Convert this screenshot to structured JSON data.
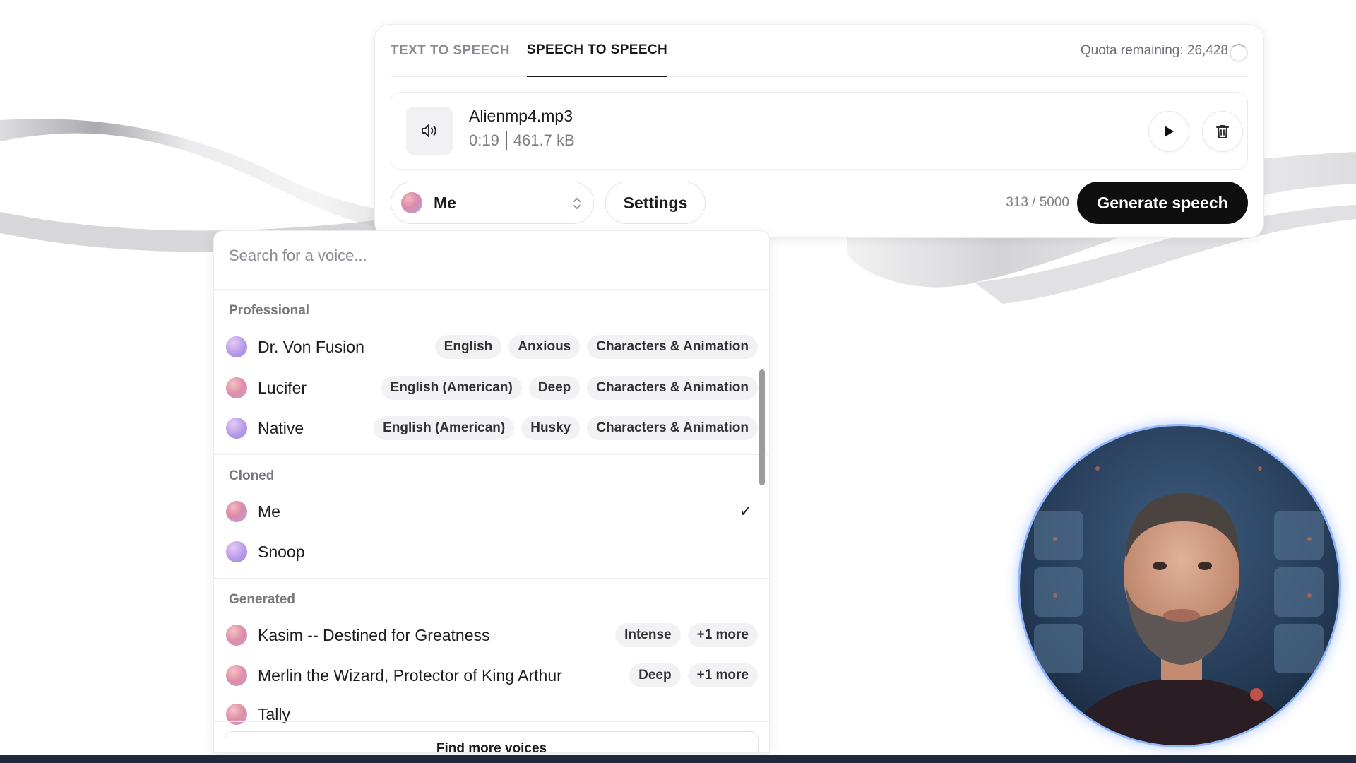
{
  "tabs": [
    {
      "label": "TEXT TO SPEECH",
      "active": false
    },
    {
      "label": "SPEECH TO SPEECH",
      "active": true
    }
  ],
  "quota": "Quota remaining: 26,428",
  "file": {
    "name": "Alienmp4.mp3",
    "duration": "0:19",
    "size": "461.7 kB"
  },
  "voice_select": {
    "selected": "Me"
  },
  "settings_label": "Settings",
  "char_count": "313 / 5000",
  "generate_label": "Generate speech",
  "dropdown": {
    "search_placeholder": "Search for a voice...",
    "groups": [
      {
        "title": "Professional",
        "voices": [
          {
            "name": "Dr. Von Fusion",
            "tags": [
              "English",
              "Anxious",
              "Characters & Animation"
            ]
          },
          {
            "name": "Lucifer",
            "tags": [
              "English (American)",
              "Deep",
              "Characters & Animation"
            ]
          },
          {
            "name": "Native",
            "tags": [
              "English (American)",
              "Husky",
              "Characters & Animation"
            ]
          }
        ]
      },
      {
        "title": "Cloned",
        "voices": [
          {
            "name": "Me",
            "selected": true,
            "check": "✓"
          },
          {
            "name": "Snoop"
          }
        ]
      },
      {
        "title": "Generated",
        "voices": [
          {
            "name": "Kasim -- Destined for Greatness",
            "tags": [
              "Intense",
              "+1 more"
            ]
          },
          {
            "name": "Merlin the Wizard, Protector of King Arthur",
            "tags": [
              "Deep",
              "+1 more"
            ]
          },
          {
            "name": "Tally"
          }
        ]
      }
    ],
    "find_more": "Find more voices"
  },
  "icons": {
    "speaker": "speaker-icon",
    "play": "play-icon",
    "trash": "trash-icon",
    "updown": "chevron-up-down-icon",
    "check": "check-icon"
  },
  "colors": {
    "primary_button": "#0f0f10",
    "tag_bg": "#f2f2f4",
    "webcam_ring": "#8fb7ff"
  }
}
